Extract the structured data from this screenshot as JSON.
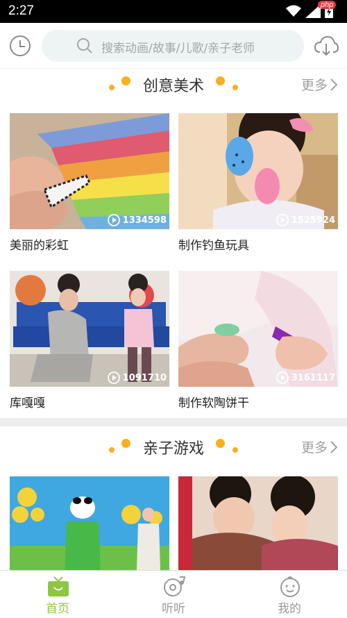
{
  "status_bar": {
    "time": "2:27",
    "badge": "php"
  },
  "search": {
    "placeholder": "搜索动画/故事/儿歌/亲子老师"
  },
  "sections": [
    {
      "title": "创意美术",
      "more": "更多",
      "items": [
        {
          "title": "美丽的彩虹",
          "plays": "1334598"
        },
        {
          "title": "制作钓鱼玩具",
          "plays": "1525924"
        },
        {
          "title": "库嘎嘎",
          "plays": "1091710"
        },
        {
          "title": "制作软陶饼干",
          "plays": "3161117"
        }
      ]
    },
    {
      "title": "亲子游戏",
      "more": "更多"
    }
  ],
  "tabs": [
    {
      "label": "首页",
      "icon": "tv-icon",
      "active": true
    },
    {
      "label": "听听",
      "icon": "headphones-icon",
      "active": false
    },
    {
      "label": "我的",
      "icon": "baby-face-icon",
      "active": false
    }
  ],
  "colors": {
    "accent": "#8dc63f",
    "dot": "#f8b020",
    "status_bar": "#000000"
  }
}
